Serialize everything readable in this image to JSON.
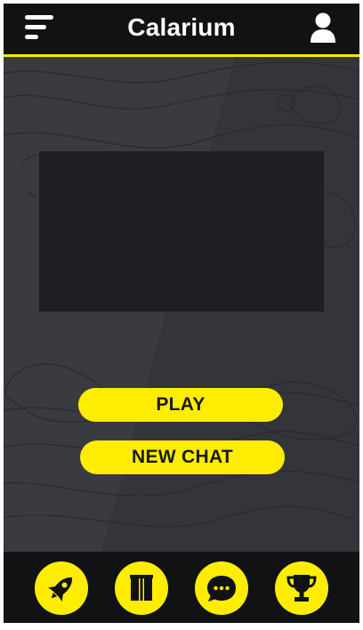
{
  "header": {
    "title": "Calarium",
    "menu_icon": "hamburger-menu-icon",
    "profile_icon": "user-icon"
  },
  "main": {
    "play_label": "PLAY",
    "new_chat_label": "NEW CHAT"
  },
  "bottom_nav": {
    "items": [
      {
        "icon": "rocket-icon"
      },
      {
        "icon": "library-icon"
      },
      {
        "icon": "chat-bubble-icon"
      },
      {
        "icon": "trophy-icon"
      }
    ]
  },
  "colors": {
    "accent": "#ffed00",
    "header_bg": "#111214",
    "page_bg": "#3a3b40",
    "media_bg": "#1e1f23"
  }
}
